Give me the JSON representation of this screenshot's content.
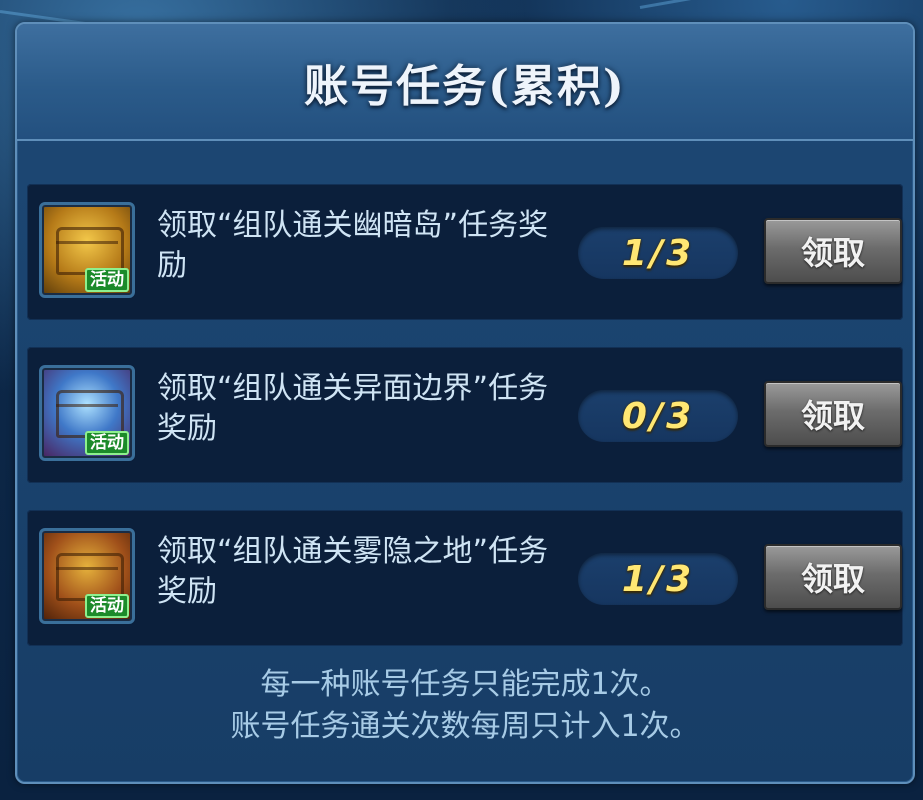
{
  "window": {
    "title": "账号任务(累积)"
  },
  "tasks": [
    {
      "icon": "gold-chest-icon",
      "tag": "活动",
      "description": "领取“组队通关幽暗岛”任务奖励",
      "progress": "1/3",
      "claim_label": "领取"
    },
    {
      "icon": "blue-chest-icon",
      "tag": "活动",
      "description": "领取“组队通关异面边界”任务奖励",
      "progress": "0/3",
      "claim_label": "领取"
    },
    {
      "icon": "golden-chest-icon",
      "tag": "活动",
      "description": "领取“组队通关雾隐之地”任务奖励",
      "progress": "1/3",
      "claim_label": "领取"
    }
  ],
  "footer": {
    "line1": "每一种账号任务只能完成1次。",
    "line2": "账号任务通关次数每周只计入1次。"
  },
  "colors": {
    "progress_text": "#ffe773",
    "event_tag_bg": "#1c8a2a",
    "panel_bg": "#173d66"
  }
}
